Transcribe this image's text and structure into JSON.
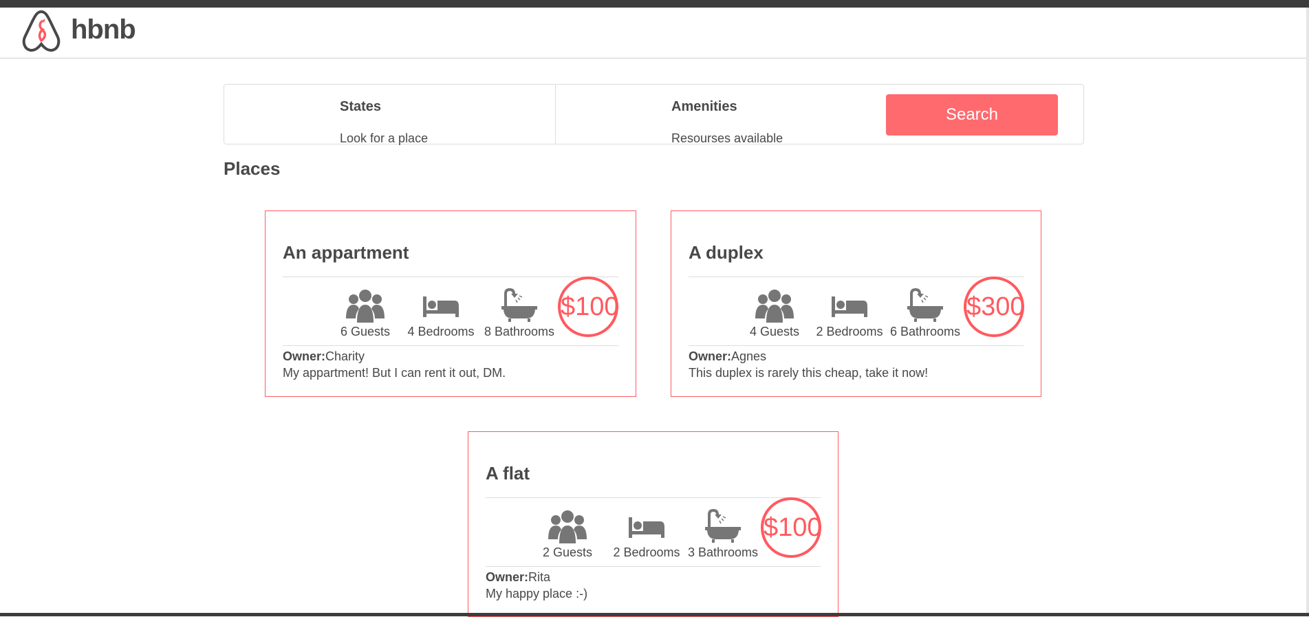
{
  "header": {
    "brand": "hbnb",
    "logo_icon": "airbnb-logo-icon",
    "accent_color": "#ff5a5f"
  },
  "filters": {
    "states": {
      "title": "States",
      "subtitle": "Look for a place"
    },
    "amenities": {
      "title": "Amenities",
      "subtitle": "Resourses available"
    },
    "search_label": "Search"
  },
  "places_title": "Places",
  "places": [
    {
      "name": "An appartment",
      "price": "$100",
      "guests": "6 Guests",
      "bedrooms": "4 Bedrooms",
      "bathrooms": "8 Bathrooms",
      "owner_label": "Owner:",
      "owner": "Charity",
      "description": "My appartment! But I can rent it out, DM."
    },
    {
      "name": "A duplex",
      "price": "$300",
      "guests": "4 Guests",
      "bedrooms": "2 Bedrooms",
      "bathrooms": "6 Bathrooms",
      "owner_label": "Owner:",
      "owner": "Agnes",
      "description": "This duplex is rarely this cheap, take it now!"
    },
    {
      "name": "A flat",
      "price": "$100",
      "guests": "2 Guests",
      "bedrooms": "2 Bedrooms",
      "bathrooms": "3 Bathrooms",
      "owner_label": "Owner:",
      "owner": "Rita",
      "description": "My happy place :-)"
    }
  ],
  "icons": [
    "group-icon",
    "bed-icon",
    "bathtub-icon"
  ]
}
